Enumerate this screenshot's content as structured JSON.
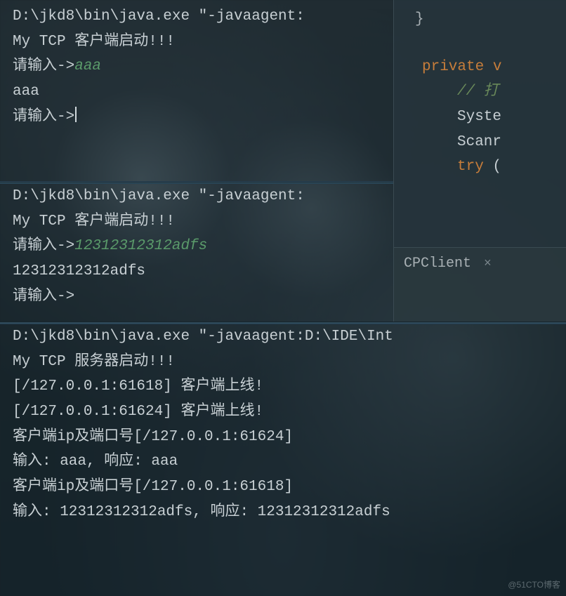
{
  "panel1": {
    "line1": "D:\\jkd8\\bin\\java.exe \"-javaagent:",
    "line2": "My TCP 客户端启动!!!",
    "prompt1": "请输入->",
    "input1": "aaa",
    "echo1": "aaa",
    "prompt2": "请输入->"
  },
  "panel2": {
    "line1": "D:\\jkd8\\bin\\java.exe \"-javaagent:",
    "line2": "My TCP 客户端启动!!!",
    "prompt1": "请输入->",
    "input1": "12312312312adfs",
    "echo1": "12312312312adfs",
    "prompt2": "请输入->"
  },
  "panel3": {
    "line1": "D:\\jkd8\\bin\\java.exe \"-javaagent:D:\\IDE\\Int",
    "line2": "My TCP 服务器启动!!!",
    "line3": "[/127.0.0.1:61618] 客户端上线!",
    "line4": "[/127.0.0.1:61624] 客户端上线!",
    "line5": "客户端ip及端口号[/127.0.0.1:61624]",
    "line6": "输入: aaa, 响应: aaa",
    "line7": "客户端ip及端口号[/127.0.0.1:61618]",
    "line8": "输入: 12312312312adfs, 响应: 12312312312adfs"
  },
  "code": {
    "brace": "}",
    "kw_private": "private ",
    "kw_v": "v",
    "comment": "// 打",
    "id_syste": "Syste",
    "id_scanr": "Scanr",
    "kw_try": "try ",
    "try_paren": "("
  },
  "tab": {
    "label": "CPClient",
    "close": "×"
  },
  "watermark": "@51CTO博客"
}
